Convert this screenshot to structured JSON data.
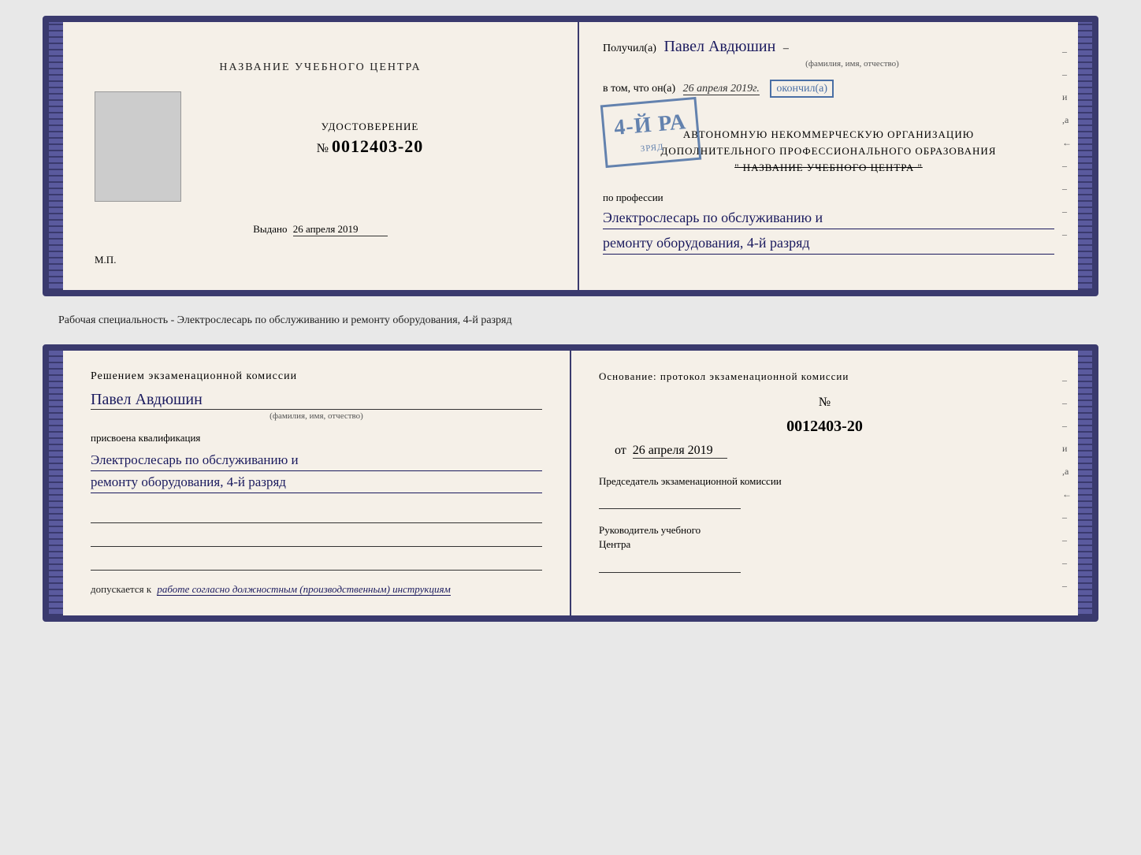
{
  "top_document": {
    "left": {
      "title": "НАЗВАНИЕ УЧЕБНОГО ЦЕНТРА",
      "cert_label": "УДОСТОВЕРЕНИЕ",
      "cert_number_prefix": "№",
      "cert_number": "0012403-20",
      "issued_label": "Выдано",
      "issued_date": "26 апреля 2019",
      "mp_label": "М.П."
    },
    "right": {
      "received_prefix": "Получил(а)",
      "person_name": "Павел Авдюшин",
      "name_label": "(фамилия, имя, отчество)",
      "in_that_prefix": "в том, что он(а)",
      "completion_date": "26 апреля 2019г.",
      "finished_label": "окончил(а)",
      "stamp_line1": "4-й ра",
      "org_line1": "АВТОНОМНУЮ НЕКОММЕРЧЕСКУЮ ОРГАНИЗАЦИЮ",
      "org_line2": "ДОПОЛНИТЕЛЬНОГО ПРОФЕССИОНАЛЬНОГО ОБРАЗОВАНИЯ",
      "org_line3": "\" НАЗВАНИЕ УЧЕБНОГО ЦЕНТРА \"",
      "profession_label": "по профессии",
      "profession_line1": "Электрослесарь по обслуживанию и",
      "profession_line2": "ремонту оборудования, 4-й разряд"
    }
  },
  "middle_text": "Рабочая специальность - Электрослесарь по обслуживанию и ремонту оборудования, 4-й разряд",
  "bottom_document": {
    "left": {
      "decision_text": "Решением экзаменационной комиссии",
      "person_name": "Павел Авдюшин",
      "name_label": "(фамилия, имя, отчество)",
      "qualification_prefix": "присвоена квалификация",
      "qualification_line1": "Электрослесарь по обслуживанию и",
      "qualification_line2": "ремонту оборудования, 4-й разряд",
      "admission_prefix": "допускается к",
      "admission_text": "работе согласно должностным (производственным) инструкциям"
    },
    "right": {
      "basis_text": "Основание: протокол экзаменационной комиссии",
      "protocol_prefix": "№",
      "protocol_number": "0012403-20",
      "date_prefix": "от",
      "protocol_date": "26 апреля 2019",
      "chairman_label": "Председатель экзаменационной комиссии",
      "director_label_line1": "Руководитель учебного",
      "director_label_line2": "Центра"
    },
    "right_margin": [
      "-",
      "-",
      "-",
      "и",
      ",а",
      "←",
      "-",
      "-",
      "-",
      "-"
    ]
  }
}
